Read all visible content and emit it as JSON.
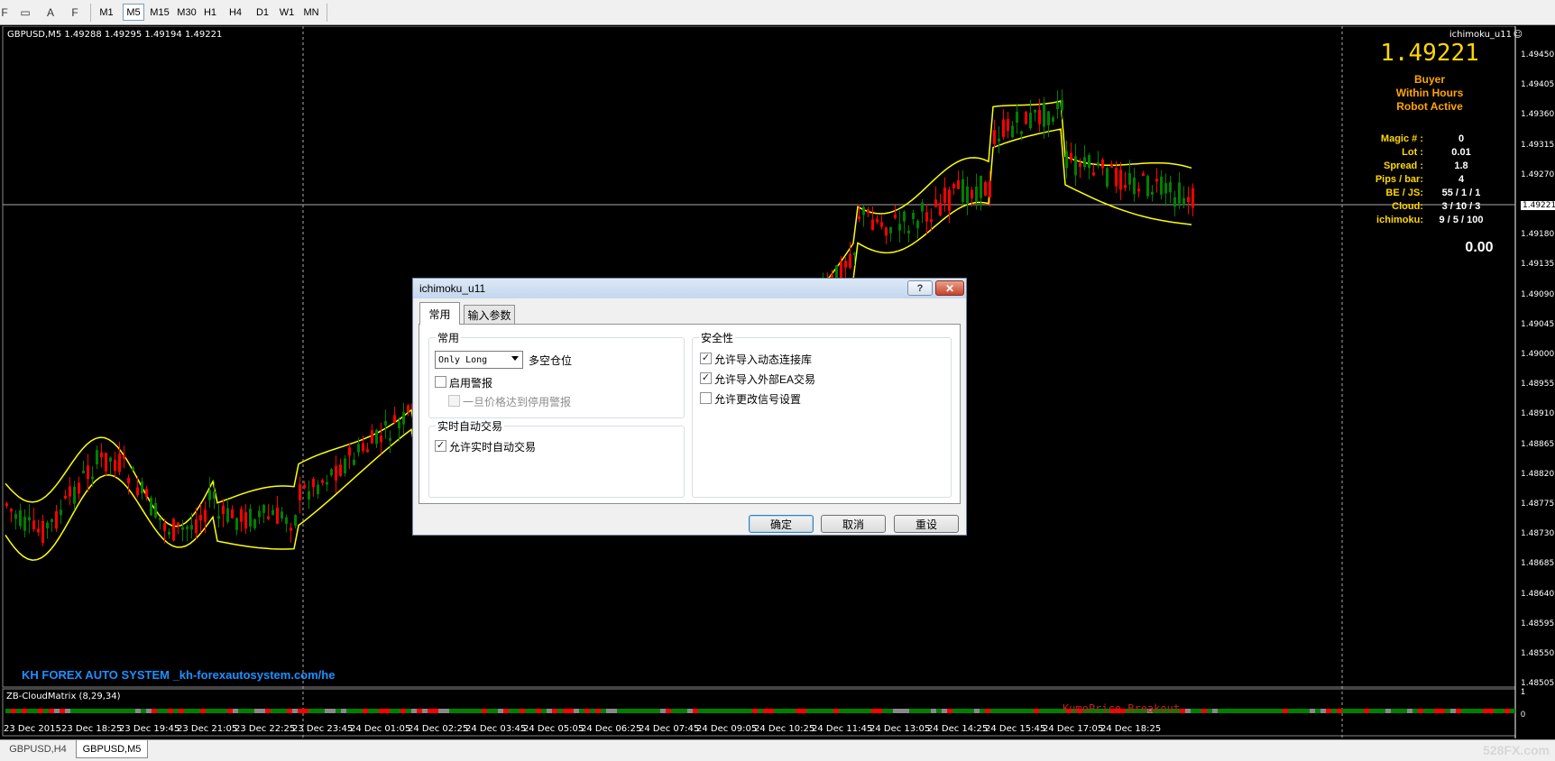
{
  "toolbar": {
    "icons": [
      "line-tool-icon",
      "rectangle-tool-icon",
      "text-tool-icon",
      "fibonacci-tool-icon"
    ],
    "icon_glyphs": [
      "F",
      "▭",
      "A",
      "F"
    ],
    "timeframes": [
      "M1",
      "M5",
      "M15",
      "M30",
      "H1",
      "H4",
      "D1",
      "W1",
      "MN"
    ],
    "active_timeframe": "M5"
  },
  "chart": {
    "symbol_info": "GBPUSD,M5  1.49288 1.49295 1.49194 1.49221",
    "ea_name": "ichimoku_u11",
    "current_price": "1.49221",
    "status": [
      "Buyer",
      "Within Hours",
      "Robot Active"
    ],
    "info": [
      {
        "label": "Magic # :",
        "value": "0"
      },
      {
        "label": "Lot :",
        "value": "0.01"
      },
      {
        "label": "Spread :",
        "value": "1.8"
      },
      {
        "label": "Pips / bar:",
        "value": "4"
      },
      {
        "label": "BE / JS:",
        "value": "55 / 1 / 1"
      },
      {
        "label": "Cloud:",
        "value": "3 / 10 / 3"
      },
      {
        "label": "ichimoku:",
        "value": "9 / 5 / 100"
      }
    ],
    "profit": "0.00",
    "brand_text": "KH FOREX AUTO SYSTEM _kh-forexautosystem.com/he",
    "indicator_label": "ZB-CloudMatrix (8,29,34)",
    "kumo_text": "KumoPrice Breakout",
    "price_axis": [
      "1.49450",
      "1.49405",
      "1.49360",
      "1.49315",
      "1.49270",
      "1.49221",
      "1.49180",
      "1.49135",
      "1.49090",
      "1.49045",
      "1.49000",
      "1.48955",
      "1.48910",
      "1.48865",
      "1.48820",
      "1.48775",
      "1.48730",
      "1.48685",
      "1.48640",
      "1.48595",
      "1.48550",
      "1.48505"
    ],
    "sub_axis": [
      "1",
      "0"
    ],
    "time_axis": [
      "23 Dec 2015",
      "23 Dec 18:25",
      "23 Dec 19:45",
      "23 Dec 21:05",
      "23 Dec 22:25",
      "23 Dec 23:45",
      "24 Dec 01:05",
      "24 Dec 02:25",
      "24 Dec 03:45",
      "24 Dec 05:05",
      "24 Dec 06:25",
      "24 Dec 07:45",
      "24 Dec 09:05",
      "24 Dec 10:25",
      "24 Dec 11:45",
      "24 Dec 13:05",
      "24 Dec 14:25",
      "24 Dec 15:45",
      "24 Dec 17:05",
      "24 Dec 18:25"
    ],
    "colors": {
      "bull": "#008000",
      "bear": "#ff0000",
      "cloud": "#ffff00",
      "price": "#ffd700",
      "status": "#ffa500",
      "brand": "#1e90ff"
    }
  },
  "tabs": [
    "GBPUSD,H4",
    "GBPUSD,M5"
  ],
  "active_tab": "GBPUSD,M5",
  "watermark": "528FX.com",
  "dialog": {
    "title": "ichimoku_u11",
    "help_glyph": "?",
    "close_glyph": "✕",
    "tabs": [
      "常用",
      "输入参数"
    ],
    "general": {
      "group_title": "常用",
      "position_select": "Only Long",
      "position_label": "多空仓位",
      "alerts_label": "启用警报",
      "alerts_checked": false,
      "stop_alert_label": "一旦价格达到停用警报",
      "stop_alert_checked": false
    },
    "live": {
      "group_title": "实时自动交易",
      "allow_live_label": "允许实时自动交易",
      "allow_live_checked": true
    },
    "safety": {
      "group_title": "安全性",
      "dll_label": "允许导入动态连接库",
      "dll_checked": true,
      "external_label": "允许导入外部EA交易",
      "external_checked": true,
      "signal_label": "允许更改信号设置",
      "signal_checked": false
    },
    "buttons": {
      "ok": "确定",
      "cancel": "取消",
      "reset": "重设"
    }
  }
}
